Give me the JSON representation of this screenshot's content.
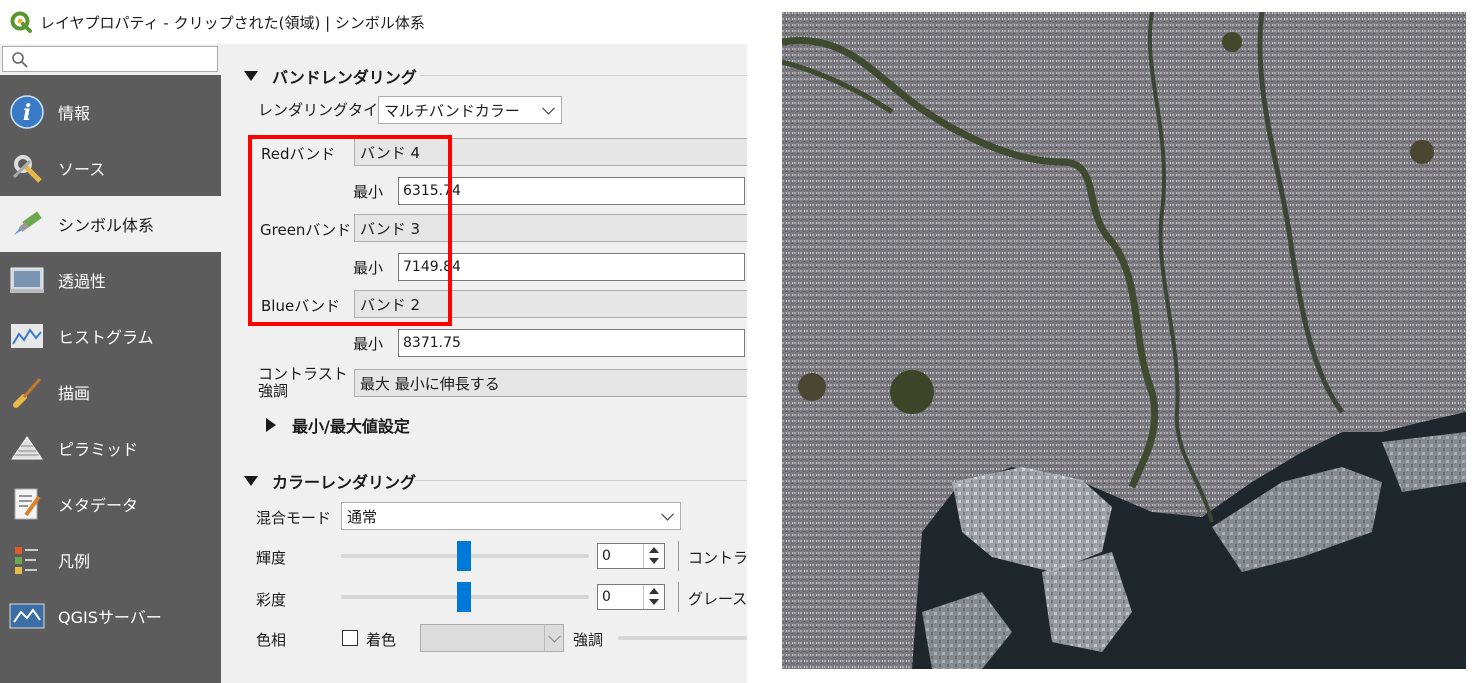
{
  "window": {
    "title": "レイヤプロパティ - クリップされた(領域) | シンボル体系",
    "app_icon": "qgis-logo-icon"
  },
  "search": {
    "placeholder": ""
  },
  "sidebar": {
    "items": [
      {
        "label": "情報",
        "icon": "info-icon",
        "selected": false
      },
      {
        "label": "ソース",
        "icon": "source-tools-icon",
        "selected": false
      },
      {
        "label": "シンボル体系",
        "icon": "paintbrush-icon",
        "selected": true
      },
      {
        "label": "透過性",
        "icon": "transparency-icon",
        "selected": false
      },
      {
        "label": "ヒストグラム",
        "icon": "histogram-icon",
        "selected": false
      },
      {
        "label": "描画",
        "icon": "rendering-brush-icon",
        "selected": false
      },
      {
        "label": "ピラミッド",
        "icon": "pyramid-icon",
        "selected": false
      },
      {
        "label": "メタデータ",
        "icon": "metadata-icon",
        "selected": false
      },
      {
        "label": "凡例",
        "icon": "legend-icon",
        "selected": false
      },
      {
        "label": "QGISサーバー",
        "icon": "qgis-server-icon",
        "selected": false
      }
    ]
  },
  "band_rendering": {
    "header": "バンドレンダリング",
    "render_type_label": "レンダリングタイプ",
    "render_type_value": "マルチバンドカラー",
    "red_label": "Redバンド",
    "red_band": "バンド 4",
    "red_min_label": "最小",
    "red_min": "6315.74",
    "green_label": "Greenバンド",
    "green_band": "バンド 3",
    "green_min_label": "最小",
    "green_min": "7149.84",
    "blue_label": "Blueバンド",
    "blue_band": "バンド 2",
    "blue_min_label": "最小",
    "blue_min": "8371.75",
    "contrast_label_line1": "コントラスト",
    "contrast_label_line2": "強調",
    "contrast_value": "最大 最小に伸長する",
    "minmax_header": "最小/最大値設定"
  },
  "color_rendering": {
    "header": "カラーレンダリング",
    "blend_label": "混合モード",
    "blend_value": "通常",
    "brightness_label": "輝度",
    "brightness_value": "0",
    "contrast_label": "コントラス",
    "saturation_label": "彩度",
    "saturation_value": "0",
    "grayscale_label": "グレース",
    "hue_label": "色相",
    "colorize_label": "着色",
    "colorize_checked": false,
    "strength_label": "強調"
  },
  "highlight_color": "#ff0000",
  "accent_color": "#0078d7"
}
